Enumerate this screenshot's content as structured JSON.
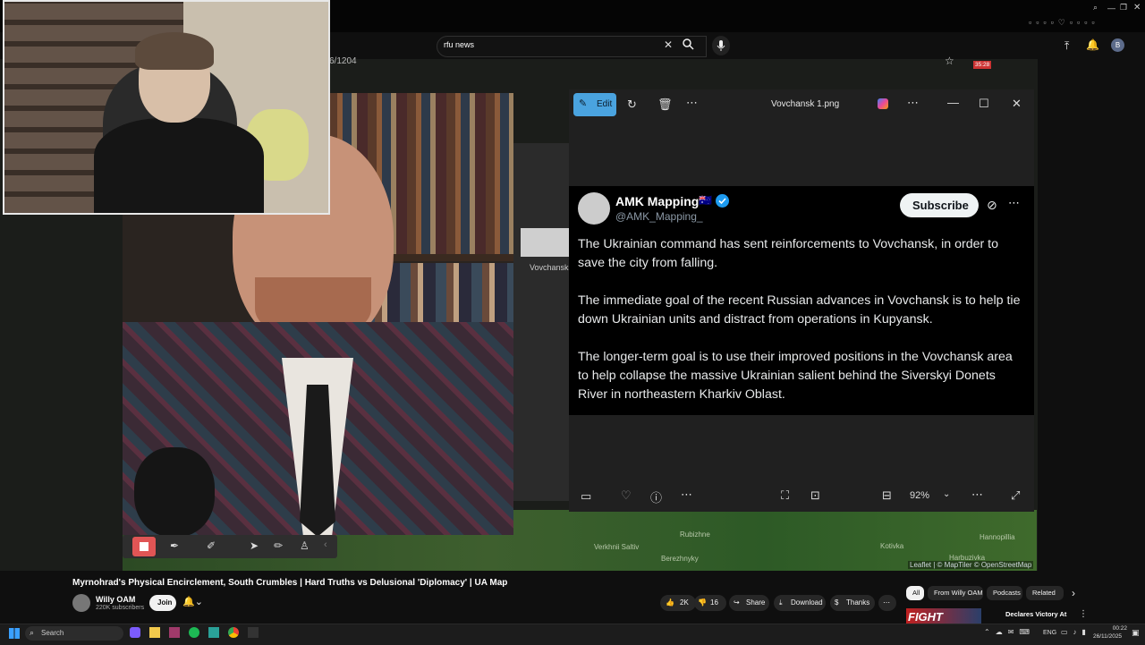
{
  "browser": {
    "search_query": "rfu news",
    "underlying_url_fragment": "6/1204"
  },
  "photos_app": {
    "edit_label": "Edit",
    "file_title": "Vovchansk 1.png",
    "zoom_level": "92%",
    "accent_color": "#4aa3df"
  },
  "tweet": {
    "author_name": "AMK Mapping",
    "author_flag": "🇦🇺",
    "handle": "@AMK_Mapping_",
    "subscribe_label": "Subscribe",
    "paragraph_1": "The Ukrainian command has sent reinforcements to Vovchansk, in order to save the city from falling.",
    "paragraph_2": "The immediate goal of the recent Russian advances in Vovchansk is to help tie down Ukrainian units and distract from operations in Kupyansk.",
    "paragraph_3": "The longer-term goal is to use their improved positions in the Vovchansk area to help collapse the massive Ukrainian salient behind the Siverskyi Donets River in northeastern Kharkiv Oblast."
  },
  "background_window": {
    "thumbnail_label": "Vovchansk"
  },
  "map": {
    "labels": [
      "Verkhnii Saltiv",
      "Rubizhne",
      "Berezhnyky",
      "Kotivka",
      "Hannopillia",
      "Harbuzivka"
    ],
    "attribution": "Leaflet | © MapTiler © OpenStreetMap"
  },
  "video": {
    "title": "Myrnohrad's Physical Encirclement, South Crumbles | Hard Truths vs Delusional 'Diplomacy' | UA Map",
    "channel_name": "Willy OAM",
    "channel_subs": "220K subscribers",
    "join_label": "Join",
    "likes": "2K",
    "dislikes": "16",
    "share_label": "Share",
    "download_label": "Download",
    "thanks_label": "Thanks"
  },
  "sidebar": {
    "chips": [
      "All",
      "From Willy OAM",
      "Podcasts",
      "Related"
    ],
    "rec_thumb_text": "FIGHT",
    "rec_title": "Declares Victory At"
  },
  "taskbar": {
    "search_placeholder": "Search",
    "language": "ENG",
    "time": "00:22",
    "date": "26/11/2025"
  },
  "notification_badge": "35:28"
}
